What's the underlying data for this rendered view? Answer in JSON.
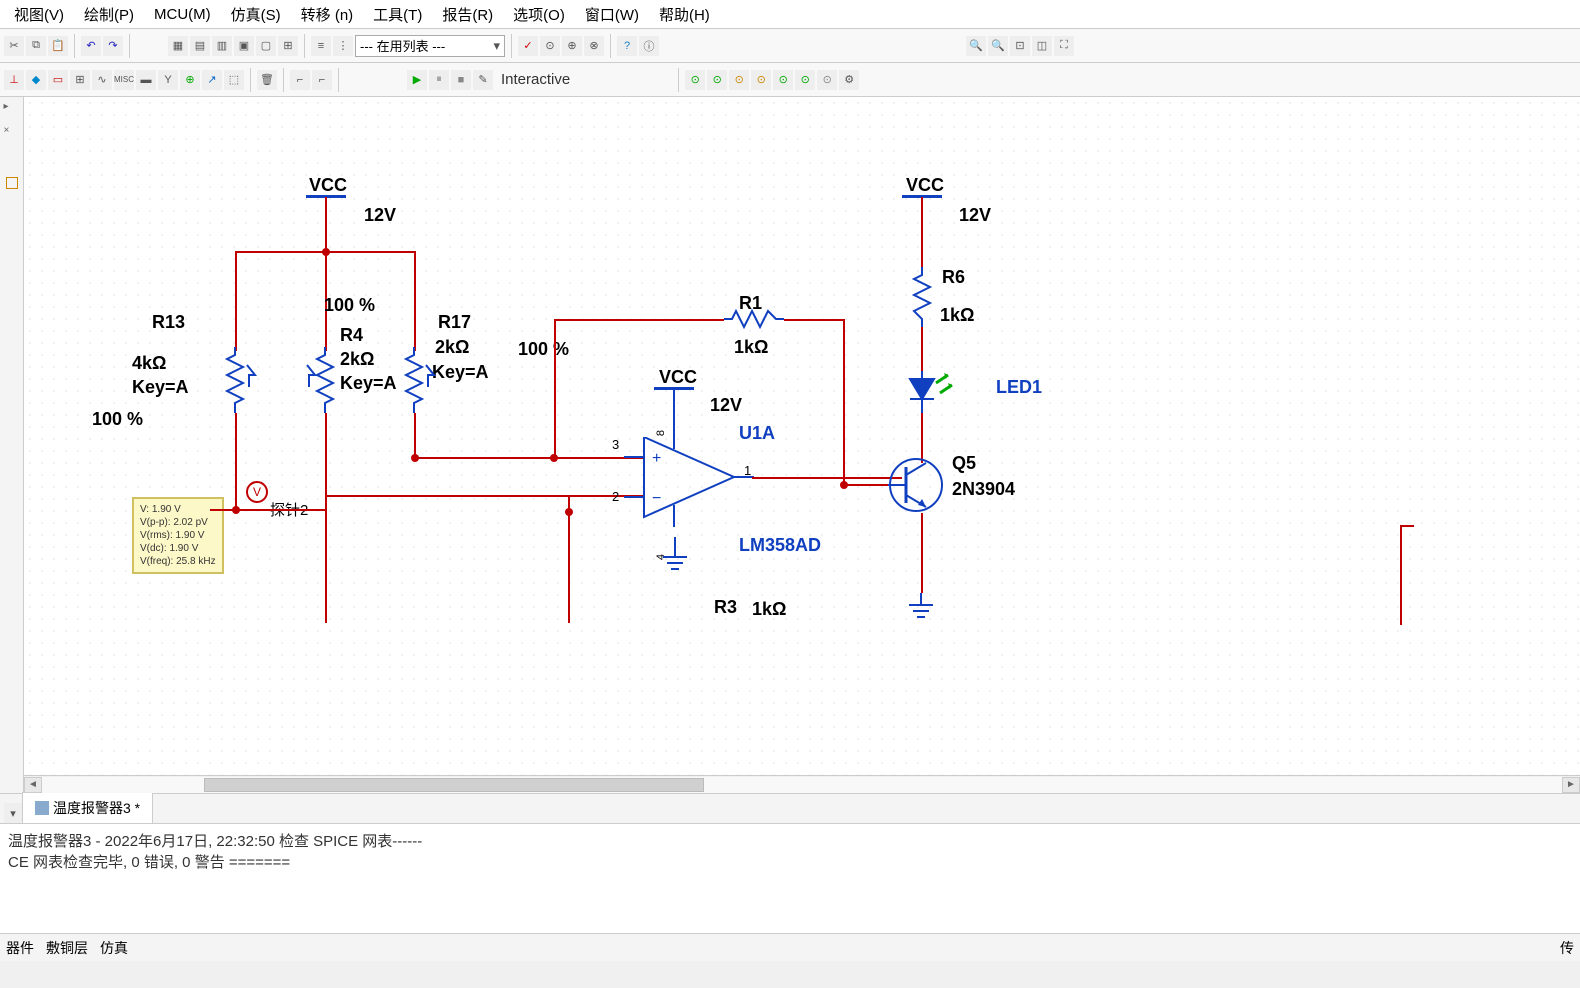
{
  "menu": {
    "view": "视图(V)",
    "draw": "绘制(P)",
    "mcu": "MCU(M)",
    "sim": "仿真(S)",
    "transfer": "转移 (n)",
    "tool": "工具(T)",
    "report": "报告(R)",
    "options": "选项(O)",
    "window": "窗口(W)",
    "help": "帮助(H)"
  },
  "toolbar": {
    "listDropdown": "--- 在用列表 ---",
    "interactive": "Interactive"
  },
  "document": {
    "tabName": "温度报警器3 *"
  },
  "log": {
    "line1": "温度报警器3 - 2022年6月17日, 22:32:50 检查 SPICE 网表------",
    "line2": "CE 网表检查完毕, 0 错误, 0 警告 ======="
  },
  "bottomTabs": {
    "t1": "器件",
    "t2": "敷铜层",
    "t3": "仿真"
  },
  "status": {
    "right": "传"
  },
  "components": {
    "vcc1": {
      "name": "VCC",
      "val": "12V"
    },
    "vcc2": {
      "name": "VCC",
      "val": "12V"
    },
    "vcc3": {
      "name": "VCC",
      "val": "12V"
    },
    "r13": {
      "name": "R13",
      "val": "4kΩ",
      "key": "Key=A",
      "pct": "100 %"
    },
    "r4": {
      "name": "R4",
      "val": "2kΩ",
      "key": "Key=A",
      "pct": "100 %"
    },
    "r17": {
      "name": "R17",
      "val": "2kΩ",
      "key": "Key=A",
      "pct": "100 %"
    },
    "r1": {
      "name": "R1",
      "val": "1kΩ"
    },
    "r6": {
      "name": "R6",
      "val": "1kΩ"
    },
    "r3": {
      "name": "R3",
      "val": "1kΩ"
    },
    "u1a": {
      "name": "U1A",
      "model": "LM358AD",
      "pin3": "3",
      "pin2": "2",
      "pin1": "1",
      "pin8": "8",
      "pin4": "4"
    },
    "q5": {
      "name": "Q5",
      "model": "2N3904"
    },
    "led1": {
      "name": "LED1"
    },
    "probe": {
      "name": "探针2",
      "v": "V: 1.90 V",
      "vpp": "V(p-p): 2.02 pV",
      "vrms": "V(rms): 1.90 V",
      "vdc": "V(dc): 1.90 V",
      "vfreq": "V(freq): 25.8 kHz"
    }
  }
}
